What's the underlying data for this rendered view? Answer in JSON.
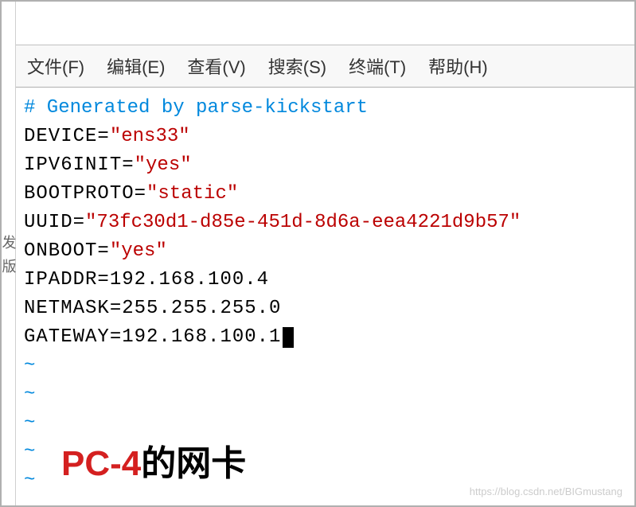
{
  "sidebar": {
    "char1": "发",
    "char2": "版"
  },
  "menu": {
    "file": "文件(F)",
    "edit": "编辑(E)",
    "view": "查看(V)",
    "search": "搜索(S)",
    "terminal": "终端(T)",
    "help": "帮助(H)"
  },
  "content": {
    "comment": "# Generated by parse-kickstart",
    "device_key": "DEVICE=",
    "device_val": "\"ens33\"",
    "ipv6_key": "IPV6INIT=",
    "ipv6_val": "\"yes\"",
    "bootproto_key": "BOOTPROTO=",
    "bootproto_val": "\"static\"",
    "uuid_key": "UUID=",
    "uuid_val": "\"73fc30d1-d85e-451d-8d6a-eea4221d9b57\"",
    "onboot_key": "ONBOOT=",
    "onboot_val": "\"yes\"",
    "ipaddr_key": "IPADDR=",
    "ipaddr_val": "192.168.100.4",
    "netmask_key": "NETMASK=",
    "netmask_val": "255.255.255.0",
    "gateway_key": "GATEWAY=",
    "gateway_val": "192.168.100.1",
    "tilde": "~"
  },
  "annotation": {
    "red": "PC-4",
    "black": "的网卡"
  },
  "watermark": "https://blog.csdn.net/BIGmustang"
}
